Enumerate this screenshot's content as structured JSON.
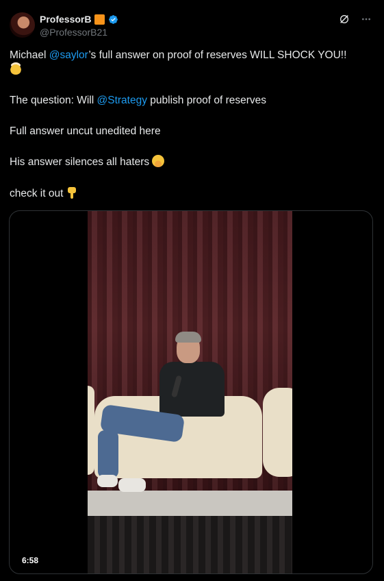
{
  "author": {
    "display_name": "ProfessorB",
    "handle": "@ProfessorB21"
  },
  "tweet": {
    "line1_pre": "Michael ",
    "line1_mention": "@saylor",
    "line1_post": "’s full answer on proof of reserves WILL SHOCK YOU!!",
    "line1_emoji": "exploding-head",
    "line2_pre": "The question: Will ",
    "line2_mention": "@Strategy",
    "line2_post": " publish proof of reserves",
    "line3": "Full answer uncut unedited here",
    "line4": "His answer silences all haters",
    "line4_emoji": "face-with-hand-over-mouth",
    "line5": "check it out",
    "line5_emoji": "backhand-index-pointing-down"
  },
  "media": {
    "duration": "6:58"
  },
  "icons": {
    "verified": "verified-badge-icon",
    "grok": "grok-icon",
    "more": "more-icon"
  },
  "colors": {
    "accent": "#1d9bf0",
    "badge_orange": "#f7931a",
    "muted": "#71767b"
  }
}
